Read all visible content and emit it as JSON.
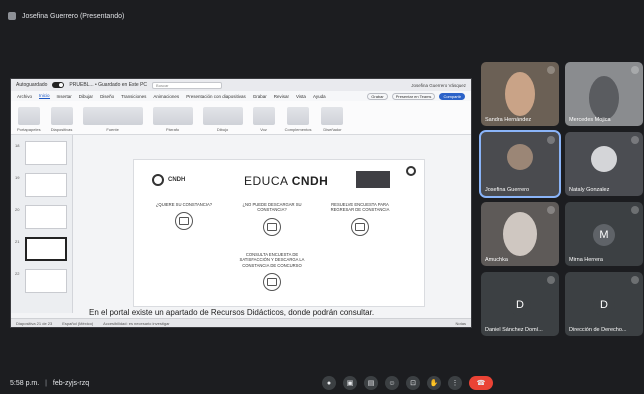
{
  "meeting": {
    "presenter_label": "Josefina Guerrero (Presentando)",
    "time": "5:58 p.m.",
    "code": "feb-zyjs-rzq"
  },
  "ppt": {
    "autosave_label": "Autoguardado",
    "file_name": "PRUEBL... • Guardado en Este PC",
    "search_placeholder": "Buscar",
    "user": "Josefina Guerrero Vásquez",
    "menu": [
      "Archivo",
      "Inicio",
      "Insertar",
      "Dibujar",
      "Diseño",
      "Transiciones",
      "Animaciones",
      "Presentación con diapositivas",
      "Grabar",
      "Revisar",
      "Vista",
      "Ayuda"
    ],
    "active_menu_index": 1,
    "buttons": [
      "Grabar",
      "Presentar en Teams",
      "Compartir"
    ],
    "ribbon": [
      "Portapapeles",
      "Diapositivas",
      "Fuente",
      "Párrafo",
      "Dibujo",
      "Voz",
      "Complementos",
      "Diseñador"
    ],
    "slide_numbers": [
      "18",
      "19",
      "20",
      "21",
      "22"
    ],
    "status": [
      "Diapositiva 21 de 23",
      "Español (México)",
      "Accesibilidad: es necesario investigar"
    ],
    "status_right": "Notas"
  },
  "slide": {
    "logo_text": "CNDH",
    "title_light": "EDUCA",
    "title_bold": "CNDH",
    "items": [
      "¿QUIERE SU CONSTANCIA?",
      "¿NO PUEDE DESCARGAR SU CONSTANCIA?",
      "RESUELVE ENCUESTA PARA REGRESAR DE CONSTANCIA",
      "CONSULTA ENCUESTA DE SATISFACCIÓN Y DESCARGA LA CONSTANCIA DE CONCURSO"
    ]
  },
  "subtitle": "En el portal existe un apartado de Recursos Didácticos, donde podrán consultar.",
  "participants": [
    {
      "name": "Sandra Hernández"
    },
    {
      "name": "Mercedes Mojica"
    },
    {
      "name": "Josefina Guerrero"
    },
    {
      "name": "Nataly Gonzalez"
    },
    {
      "name": "Amuchka"
    },
    {
      "name": "Mirna Herrera",
      "initial": "M",
      "color": "#5f6368"
    },
    {
      "name": "Daniel Sánchez Domí...",
      "initial": "D",
      "color": "#3c4043"
    },
    {
      "name": "Dirección de Derecho...",
      "initial": "D",
      "color": "#3c4043"
    }
  ]
}
